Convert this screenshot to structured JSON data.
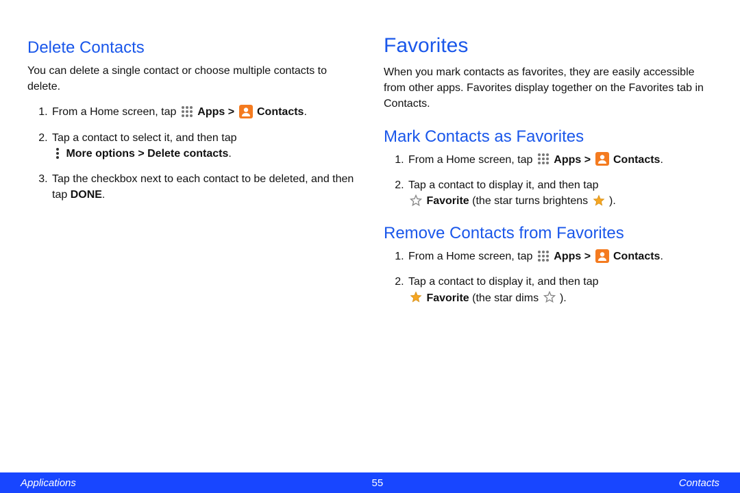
{
  "footer": {
    "left": "Applications",
    "page": "55",
    "right": "Contacts"
  },
  "left": {
    "title": "Delete Contacts",
    "intro": "You can delete a single contact or choose multiple contacts to delete.",
    "steps": {
      "s1_a": "From a Home screen, tap ",
      "s1_apps": "Apps",
      "s1_gt": " > ",
      "s1_contacts": "Contacts",
      "s1_end": ".",
      "s2_a": "Tap a contact to select it, and then tap ",
      "s2_b": "More options > Delete contacts",
      "s2_end": ".",
      "s3_a": "Tap the checkbox next to each contact to be deleted, and then tap ",
      "s3_b": "DONE",
      "s3_end": "."
    }
  },
  "right": {
    "title": "Favorites",
    "intro": "When you mark contacts as favorites, they are easily accessible from other apps. Favorites display together on the Favorites tab in Contacts.",
    "mark": {
      "title": "Mark Contacts as Favorites",
      "s1_a": "From a Home screen, tap ",
      "s1_apps": "Apps",
      "s1_gt": " > ",
      "s1_contacts": "Contacts",
      "s1_end": ".",
      "s2_a": "Tap a contact to display it, and then tap ",
      "s2_fav": "Favorite",
      "s2_mid": " (the star turns brightens ",
      "s2_end": ")."
    },
    "remove": {
      "title": "Remove Contacts from Favorites",
      "s1_a": "From a Home screen, tap ",
      "s1_apps": "Apps",
      "s1_gt": " > ",
      "s1_contacts": "Contacts",
      "s1_end": ".",
      "s2_a": "Tap a contact to display it, and then tap ",
      "s2_fav": "Favorite",
      "s2_mid": " (the star dims ",
      "s2_end": ")."
    }
  }
}
